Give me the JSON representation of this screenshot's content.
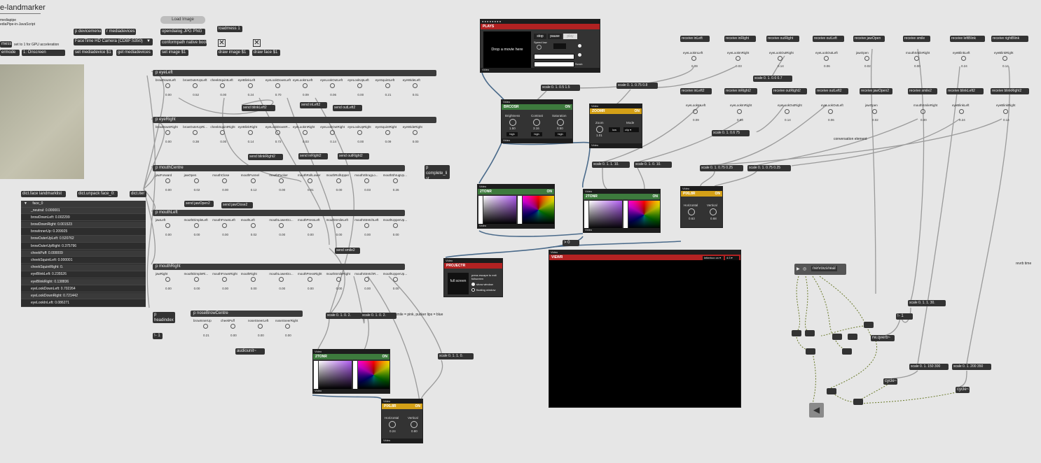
{
  "title": "e-landmarker",
  "note": "mediapipe\nediaPipe-in-JavaScript",
  "ui": {
    "load_image": "Load Image",
    "p_devicemenu": "p devicemenu",
    "r_mediadevices": "r mediadevices",
    "camera_menu": "FaceTime HD Camera (CDBF:5350)",
    "set_mediadevice": "set  mediadevice $1",
    "get_mediadevices": "get  mediadevices",
    "opendialog": "opendialog  JPG  PNG",
    "conformpath": "conformpath  native boot",
    "set_image": "set  image $1",
    "loadmess": "loadmess 1",
    "draw_image": "draw  image $1",
    "draw_face": "draw  face $1",
    "mess1": "mess 1",
    "gpu_note": "set to 1 for GPU acceleration",
    "ermode": "ermode",
    "onscreen": "1: Onscreen",
    "dict_face": "dict.face  landmarklist",
    "dict_unpack": "dict.unpack  face_0:",
    "dict_iter": "dict.iter",
    "complete_list": "p complete_li st",
    "p_headindex": "p headindex",
    "minus1": "!- 1",
    "audiounit": "audiounit~",
    "smile_note": "smile = pink, pucker lips = blue",
    "gt0": "> 0",
    "eq1": "!- 1",
    "conversation": "conversation element",
    "rev_time": "revrb time",
    "nervous": "nervousneal"
  },
  "dict": {
    "header": "face_0",
    "rows": [
      "_neutral: 0.000001",
      "browDownLeft: 0.002299",
      "browDownRight: 0.001523",
      "browInnerUp: 0.209925",
      "browOuterUpLeft: 0.520762",
      "browOuterUpRight: 0.375796",
      "cheekPuff: 0.000009",
      "cheekSquintLeft: 0.000001",
      "cheekSquintRight: 0.",
      "eyeBlinkLeft: 0.235526",
      "eyeBlinkRight: 0.138836",
      "eyeLookDownLeft: 0.702264",
      "eyeLookDownRight: 0.721442",
      "eyeLookInLeft: 0.086271"
    ]
  },
  "subpatches": {
    "eyeLeft": {
      "name": "p eyeLeft",
      "labels": [
        "browDownLeft",
        "browOuterUpLeft",
        "cheekSquintLeft",
        "eyeBlinkLeft",
        "eyeLookDownLeft",
        "eyeLookInLeft",
        "eyeLookOutLeft",
        "eyeLookUpLeft",
        "eyeSquintLeft",
        "eyeWideLeft"
      ],
      "values": [
        "0.00",
        "0.52",
        "0.00",
        "0.24",
        "0.70",
        "0.09",
        "0.06",
        "0.00",
        "0.21",
        "0.01"
      ]
    },
    "eyeRight": {
      "name": "p eyeRight",
      "labels": [
        "browDownRight",
        "browOuterUpRi...",
        "cheekSquintRight",
        "eyeBlinkRight",
        "eyeLookDownR...",
        "eyeLookInRight",
        "eyeLookOutRight",
        "eyeLookUpRight",
        "eyeSquintRight",
        "eyeWideRight"
      ],
      "values": [
        "0.00",
        "0.38",
        "0.00",
        "0.14",
        "0.72",
        "0.03",
        "0.14",
        "0.00",
        "0.09",
        "0.00"
      ]
    },
    "mouthCentre": {
      "name": "p mouthCentre",
      "labels": [
        "jawForward",
        "jawOpen",
        "mouthClose",
        "mouthFunnel",
        "mouthPucker",
        "mouthRollLower",
        "mouthRollUpper",
        "mouthShrugLo...",
        "mouthShrugUp..."
      ],
      "values": [
        "0.00",
        "0.02",
        "0.00",
        "0.12",
        "0.00",
        "0.01",
        "0.00",
        "0.03",
        "0.26"
      ]
    },
    "mouthLeft": {
      "name": "p mouthLeft",
      "labels": [
        "jawLeft",
        "mouthDimpleLeft",
        "mouthFrownLeft",
        "mouthLeft",
        "mouthLowerDo...",
        "mouthPressLeft",
        "mouthSmileLeft",
        "mouthStretchLeft",
        "mouthUpperUp..."
      ],
      "values": [
        "0.00",
        "0.00",
        "0.00",
        "0.02",
        "0.00",
        "0.00",
        "0.00",
        "0.00",
        "0.00"
      ]
    },
    "mouthRight": {
      "name": "p mouthRight",
      "labels": [
        "jawRight",
        "mouthDimpleRi...",
        "mouthFrownRight",
        "mouthRight",
        "mouthLowerDo...",
        "mouthPressRight",
        "mouthSmileRight",
        "mouthStretchR...",
        "mouthUpperUp..."
      ],
      "values": [
        "0.00",
        "0.00",
        "0.00",
        "0.00",
        "0.00",
        "0.00",
        "0.00",
        "0.00",
        "0.00"
      ]
    },
    "noseBrow": {
      "name": "p noseBrowCentre",
      "labels": [
        "browInnerUp",
        "cheekPuff",
        "noseSneerLeft",
        "noseSneerRight"
      ],
      "values": [
        "0.21",
        "0.00",
        "0.00",
        "0.00"
      ]
    }
  },
  "sends": [
    "send blinkLeft2",
    "send inLeft2",
    "send outLeft2",
    "send blinkRight2",
    "send inRight2",
    "send outRight2",
    "send jawOpen2",
    "send jawClose2",
    "send smile2"
  ],
  "receives1": [
    {
      "name": "receive inLeft",
      "label": "eyeLookInLeft",
      "value": "0.09"
    },
    {
      "name": "receive inRight",
      "label": "eyeLookInRight",
      "value": "0.03"
    },
    {
      "name": "receive outRight",
      "label": "eyeLookOutRight",
      "value": "0.14"
    },
    {
      "name": "receive outLeft",
      "label": "eyeLookOutLeft",
      "value": "0.06"
    },
    {
      "name": "receive jawOpen",
      "label": "jawOpen",
      "value": "0.02"
    },
    {
      "name": "receive smile",
      "label": "mouthSmileRight",
      "value": "0.00"
    },
    {
      "name": "receive leftBlink",
      "label": "eyeBlinkLeft",
      "value": "0.24"
    },
    {
      "name": "receive rightBlink",
      "label": "eyeBlinkRight",
      "value": "0.14"
    }
  ],
  "receives2": [
    {
      "name": "receive inLeft2",
      "label": "eyeLookInLeft",
      "value": "0.09"
    },
    {
      "name": "receive inRight2",
      "label": "eyeLookInRight",
      "value": "0.03"
    },
    {
      "name": "receive outRight2",
      "label": "eyeLookOutRight",
      "value": "0.14"
    },
    {
      "name": "receive outLeft2",
      "label": "eyeLookOutLeft",
      "value": "0.06"
    },
    {
      "name": "receive jawOpen2",
      "label": "jawOpen",
      "value": "0.02"
    },
    {
      "name": "receive smile2",
      "label": "mouthSmileRight",
      "value": "0.00"
    },
    {
      "name": "receive blinkLeft2",
      "label": "eyeBlinkLeft",
      "value": "0.24"
    },
    {
      "name": "receive blinkRight2",
      "label": "eyeBlinkRight",
      "value": "0.14"
    }
  ],
  "scales": [
    "scale 0. 1. 0.5 1.5",
    "scale 0. 1. 0.75 0.8",
    "scale 0. 1. 0.6 0.7",
    "scale 0. 1. 0.6 75",
    "scale 0. 1. 1. 10.",
    "scale 0. 1. 0. 10.",
    "scale 0. 1. 0.75 0.25",
    "scale 0. 1. 0.75 0.25",
    "scale 0. 1. 0. 2.",
    "scale 0. 1. 0. 2.",
    "scale 0. 1. 1. 0.",
    "scale 0. 1. 1. 30.",
    "scale 0. 1. 150 300",
    "scale 0. 1. 200 350"
  ],
  "vizzie": {
    "plays": {
      "title": "PLAYS",
      "drop": "Drop a movie here",
      "stop": "stop",
      "pause": "pause",
      "play": "play",
      "speed": "Speed low",
      "scrub": "Scrub",
      "video": "Video"
    },
    "brcosr": {
      "title": "BRCOSR",
      "on": "ON",
      "brightness": "Brightness",
      "contrast": "Contrast",
      "saturation": "Saturation",
      "b_val": "1.50",
      "c_val": "3.16",
      "s_val": "0.50",
      "high": "high",
      "video": "Video"
    },
    "zoomr": {
      "title": "ZOOMR",
      "on": "ON",
      "zoom": "Zoom",
      "mode": "Mode",
      "zval": "1.01",
      "mode_val": "clip",
      "low": "low",
      "video": "Video"
    },
    "twotonr1": {
      "title": "2TONR",
      "on": "ON",
      "video": "Video"
    },
    "twotonr2": {
      "title": "2TONR",
      "on": "ON",
      "video": "Video"
    },
    "twotonr3": {
      "title": "2TONR",
      "on": "ON",
      "video": "Video"
    },
    "pixlr1": {
      "title": "PIXL8R",
      "on": "ON",
      "horizontal": "Horizontal",
      "vertical": "Vertical",
      "h": "0.63",
      "v": "0.68",
      "video": "Video"
    },
    "pixlr2": {
      "title": "PIXL8R",
      "on": "ON",
      "horizontal": "Horizontal",
      "vertical": "Vertical",
      "h": "0.24",
      "v": "0.80",
      "video": "Video"
    },
    "projectr": {
      "title": "PROJECTR",
      "full": "full screen",
      "press": "press escape to exit fullscreen",
      "show": "show window",
      "floating": "floating window",
      "video": "Video"
    },
    "viewr": {
      "title": "VIEWR",
      "aspect": "letterbox on",
      "ratio": "4:3",
      "video": "Video"
    }
  },
  "audio": [
    "cycle~",
    "cycle~",
    "rw.qverb~"
  ],
  "colors": {
    "bg": "#e6e6e6",
    "obj": "#333333",
    "plays": "#b22222",
    "brcosr": "#3d7a3d",
    "zoomr": "#d4a017",
    "pixlr": "#d4a017",
    "twotonr": "#3d7a3d",
    "projectr": "#b22222",
    "viewr": "#b22222"
  }
}
